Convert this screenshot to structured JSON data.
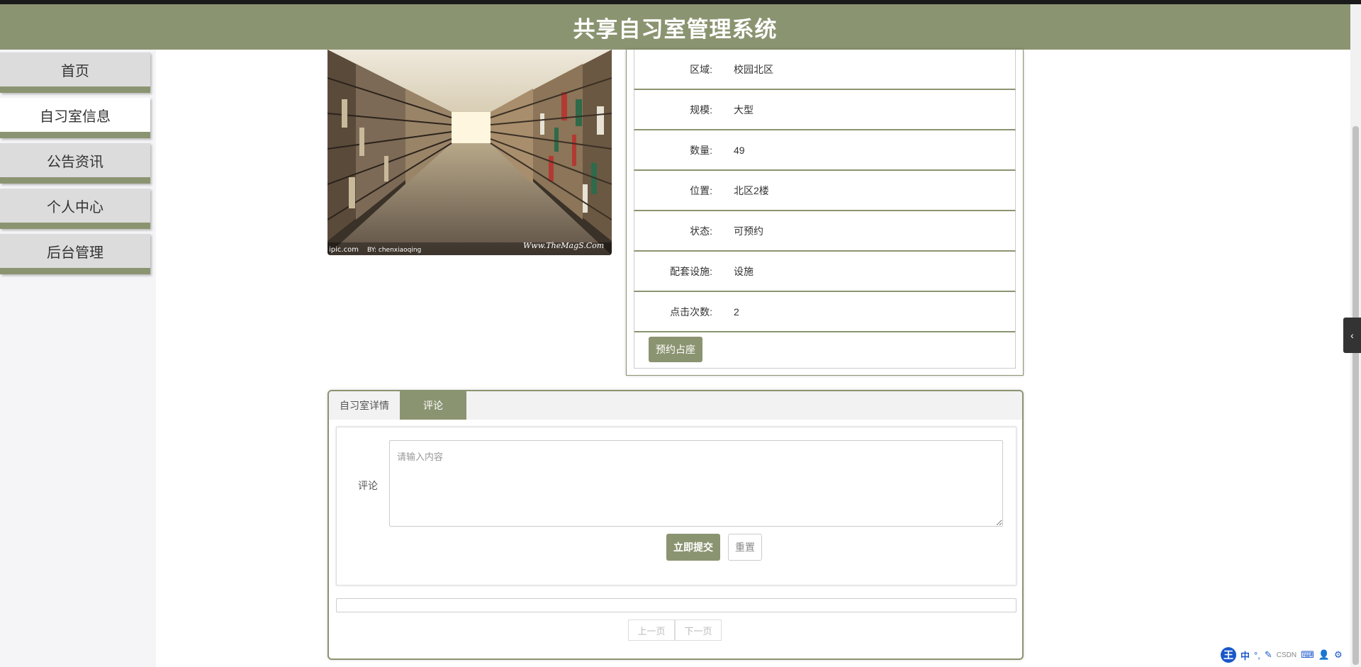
{
  "app": {
    "title": "共享自习室管理系统"
  },
  "sidebar": {
    "items": [
      {
        "label": "首页"
      },
      {
        "label": "自习室信息"
      },
      {
        "label": "公告资讯"
      },
      {
        "label": "个人中心"
      },
      {
        "label": "后台管理"
      }
    ],
    "active_index": 1
  },
  "photo": {
    "watermark_left": "ipic.com",
    "watermark_mid": "BY: chenxiaoqing",
    "watermark_right": "Www.TheMagS.Com"
  },
  "details": {
    "rows": [
      {
        "label": "区域:",
        "value": "校园北区"
      },
      {
        "label": "规模:",
        "value": "大型"
      },
      {
        "label": "数量:",
        "value": "49"
      },
      {
        "label": "位置:",
        "value": "北区2楼"
      },
      {
        "label": "状态:",
        "value": "可预约"
      },
      {
        "label": "配套设施:",
        "value": "设施"
      },
      {
        "label": "点击次数:",
        "value": "2"
      }
    ],
    "reserve_label": "预约占座"
  },
  "tabs": [
    {
      "label": "自习室详情"
    },
    {
      "label": "评论"
    }
  ],
  "comment_form": {
    "label": "评论",
    "placeholder": "请输入内容",
    "submit_label": "立即提交",
    "reset_label": "重置"
  },
  "pager": {
    "prev": "上一页",
    "next": "下一页"
  },
  "side_toggle": {
    "icon": "chevron-left-icon",
    "glyph": "‹"
  },
  "ime": {
    "logo": "王",
    "mode": "中",
    "faint": "CSDN"
  },
  "colors": {
    "accent": "#8b9471",
    "header_text": "#ffffff"
  }
}
